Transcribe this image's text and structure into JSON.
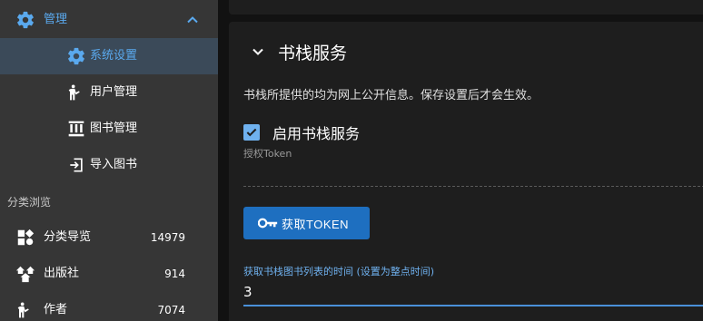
{
  "sidebar": {
    "group": {
      "label": "管理"
    },
    "items": [
      {
        "label": "系统设置"
      },
      {
        "label": "用户管理"
      },
      {
        "label": "图书管理"
      },
      {
        "label": "导入图书"
      }
    ],
    "section_label": "分类浏览",
    "categories": [
      {
        "label": "分类导览",
        "count": "14979"
      },
      {
        "label": "出版社",
        "count": "914"
      },
      {
        "label": "作者",
        "count": "7074"
      }
    ]
  },
  "colors": {
    "accent": "#5aa9ee",
    "button": "#1e6fc0",
    "active_row": "#3b4a59"
  },
  "card": {
    "title": "书栈服务",
    "description": "书栈所提供的均为网上公开信息。保存设置后才会生效。",
    "checkbox_label": "启用书栈服务",
    "checkbox_checked": true,
    "hint": "授权Token",
    "button_label": "获取TOKEN",
    "field_label": "获取书栈图书列表的时间 (设置为整点时间)",
    "field_value": "3"
  }
}
